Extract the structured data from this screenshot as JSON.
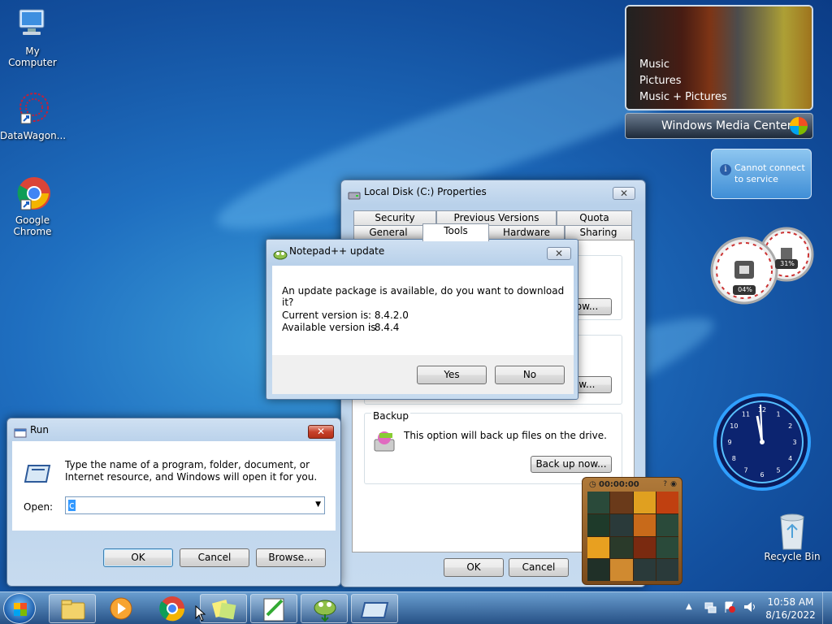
{
  "desktop": {
    "icons": [
      {
        "label": "My Computer"
      },
      {
        "label": "DataWagon..."
      },
      {
        "label": "Google Chrome"
      },
      {
        "label": "Recycle Bin"
      }
    ]
  },
  "media_center": {
    "items": [
      "Music",
      "Pictures",
      "Music + Pictures"
    ],
    "brand": "Windows Media Center"
  },
  "weather": {
    "text": "Cannot connect to service"
  },
  "meters": {
    "cpu": "04%",
    "memory": "31%",
    "cpu_value": 0.04,
    "memory_value": 0.31
  },
  "clock": {
    "numbers": [
      "12",
      "1",
      "2",
      "3",
      "4",
      "5",
      "6",
      "7",
      "8",
      "9",
      "10",
      "11"
    ]
  },
  "puzzle": {
    "timer": "00:00:00"
  },
  "properties": {
    "title": "Local Disk (C:) Properties",
    "tabs_row1": [
      "Security",
      "Previous Versions",
      "Quota"
    ],
    "tabs_row2": [
      "General",
      "Tools",
      "Hardware",
      "Sharing"
    ],
    "btn1": "...now...",
    "btn2": "...ow...",
    "backup": {
      "label": "Backup",
      "desc": "This option will back up files on the drive.",
      "button": "Back up now..."
    },
    "ok": "OK",
    "cancel": "Cancel"
  },
  "npp": {
    "title": "Notepad++ update",
    "message": "An update package is available, do you want to download it?",
    "current_label": "Current version is",
    "current_value": ": 8.4.2.0",
    "available_label": "Available version is",
    "available_value": ": 8.4.4",
    "yes": "Yes",
    "no": "No"
  },
  "run": {
    "title": "Run",
    "message": "Type the name of a program, folder, document, or Internet resource, and Windows will open it for you.",
    "open_label": "Open:",
    "open_value": "c",
    "ok": "OK",
    "cancel": "Cancel",
    "browse": "Browse..."
  },
  "taskbar": {
    "time": "10:58 AM",
    "date": "8/16/2022",
    "items": [
      "start-button",
      "explorer",
      "media-player",
      "chrome",
      "sticky-notes",
      "notepad-plus-plus-editor",
      "notepad-plus-plus-updater",
      "run-dialog"
    ]
  }
}
